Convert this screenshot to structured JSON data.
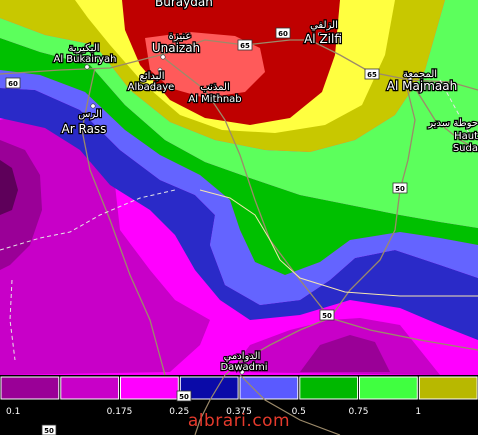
{
  "map": {
    "places": [
      {
        "id": "buraydah",
        "name": "Buraydah",
        "arabic": ""
      },
      {
        "id": "unaizah",
        "name": "Unaizah",
        "arabic": "عنيزة"
      },
      {
        "id": "al-bukairyah",
        "name": "Al Bukairyah",
        "arabic": "البكيرية"
      },
      {
        "id": "albadaye",
        "name": "Albadaye",
        "arabic": "البدائع"
      },
      {
        "id": "al-mithnab",
        "name": "Al Mithnab",
        "arabic": "المذنب"
      },
      {
        "id": "al-zilfi",
        "name": "Al Zilfi",
        "arabic": "الزلفي"
      },
      {
        "id": "al-majmaah",
        "name": "Al Majmaah",
        "arabic": "المجمعة"
      },
      {
        "id": "ar-rass",
        "name": "Ar Rass",
        "arabic": "الرس"
      },
      {
        "id": "dawadmi",
        "name": "Dawadmi",
        "arabic": "الدوادمي"
      },
      {
        "id": "haut-sudair",
        "name": "Haut Sudair",
        "arabic": "حوطة سدير",
        "line1": "Haut",
        "line2": "Suda"
      }
    ],
    "road_shields": [
      "60",
      "65",
      "60",
      "65",
      "50",
      "50",
      "50"
    ]
  },
  "legend": {
    "ticks": [
      "0.1",
      "0.175",
      "0.25",
      "0.375",
      "0.5",
      "0.75",
      "1"
    ],
    "colors": [
      "#9a0097",
      "#c800c8",
      "#ff00ff",
      "#0a0aa8",
      "#5a5aff",
      "#00b800",
      "#40ff40",
      "#b8b800"
    ]
  },
  "palette": {
    "darkred": "#bf0000",
    "red": "#ff5a5a",
    "yellow": "#ffff40",
    "olive": "#c8c800",
    "lightgreen": "#5cff5c",
    "green": "#00c000",
    "blue": "#6464ff",
    "navy": "#2a2ac8",
    "magenta": "#ff00ff",
    "purple": "#c800c8",
    "darkpurple": "#9a0097"
  },
  "watermark": "albrari.com"
}
